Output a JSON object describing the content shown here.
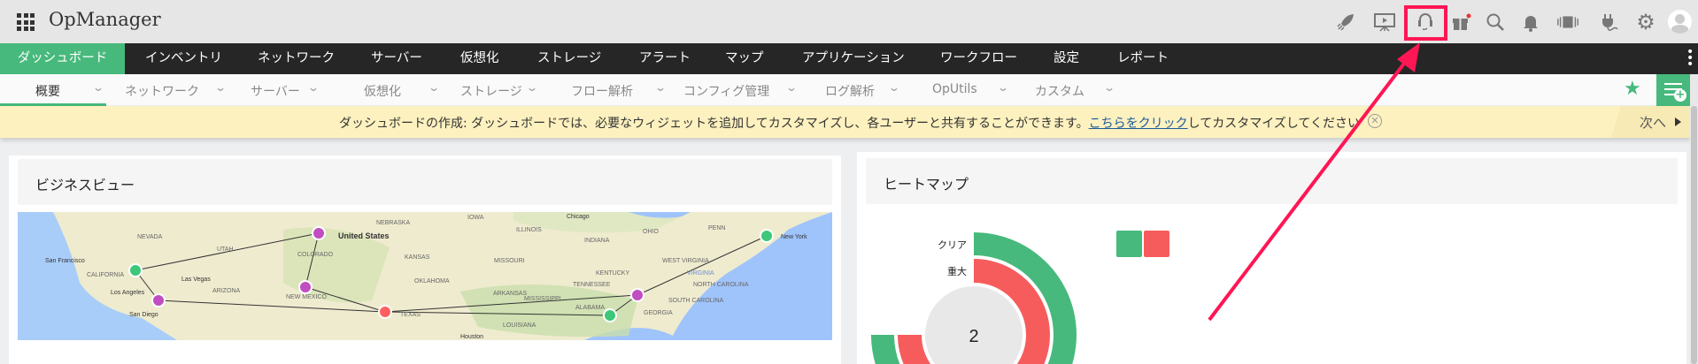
{
  "app": {
    "title": "OpManager"
  },
  "topbar_icons": [
    "rocket-icon",
    "presentation-icon",
    "headset-icon",
    "gift-icon",
    "search-icon",
    "bell-icon",
    "vibrate-icon",
    "plug-icon",
    "gear-icon",
    "avatar-icon"
  ],
  "nav": {
    "items": [
      "ダッシュボード",
      "インベントリ",
      "ネットワーク",
      "サーバー",
      "仮想化",
      "ストレージ",
      "アラート",
      "マップ",
      "アプリケーション",
      "ワークフロー",
      "設定",
      "レポート"
    ],
    "active": "ダッシュボード"
  },
  "subnav": {
    "items": [
      "概要",
      "ネットワーク",
      "サーバー",
      "仮想化",
      "ストレージ",
      "フロー解析",
      "コンフィグ管理",
      "ログ解析",
      "OpUtils",
      "カスタム"
    ],
    "active": "概要"
  },
  "banner": {
    "prefix": "ダッシュボードの作成: ダッシュボードでは、必要なウィジェットを追加してカスタマイズし、各ユーザーと共有することができます。",
    "link": "こちらをクリック",
    "suffix": "してカスタマイズしてください",
    "next": "次へ"
  },
  "business_view": {
    "title": "ビジネスビュー",
    "labels": [
      "United States",
      "NEVADA",
      "UTAH",
      "COLORADO",
      "NEBRASKA",
      "IOWA",
      "ILLINOIS",
      "INDIANA",
      "OHIO",
      "PENN",
      "New York",
      "San Francisco",
      "CALIFORNIA",
      "Las Vegas",
      "Los Angeles",
      "San Diego",
      "ARIZONA",
      "NEW MEXICO",
      "TEXAS",
      "KANSAS",
      "MISSOURI",
      "OKLAHOMA",
      "ARKANSAS",
      "MISSISSIPPI",
      "ALABAMA",
      "GEORGIA",
      "LOUISIANA",
      "Houston",
      "KENTUCKY",
      "TENNESSEE",
      "WEST VIRGINIA",
      "VIRGINIA",
      "NORTH CAROLINA",
      "SOUTH CAROLINA",
      "Chicago"
    ]
  },
  "heatmap": {
    "title": "ヒートマップ",
    "labels": [
      "クリア",
      "重大"
    ],
    "center_value": "2",
    "colors": {
      "clear": "#47b97c",
      "critical": "#f75c5c"
    }
  },
  "colors": {
    "accent": "#47b97c",
    "highlight": "#ff1654"
  }
}
